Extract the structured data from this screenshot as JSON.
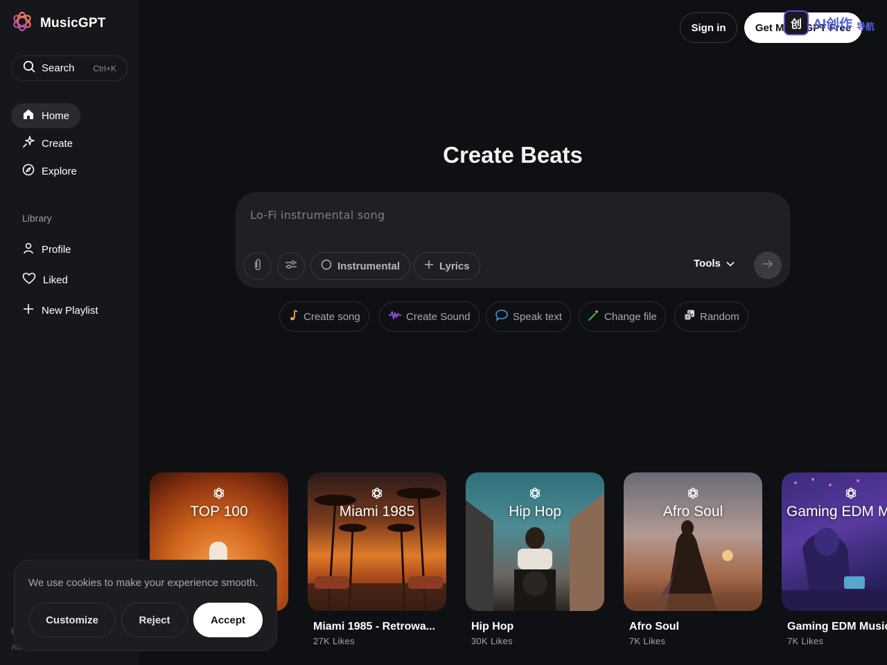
{
  "brand": {
    "name": "MusicGPT"
  },
  "sidebar": {
    "search": {
      "label": "Search",
      "shortcut": "Ctrl+K"
    },
    "nav": [
      {
        "label": "Home",
        "icon": "home-icon",
        "active": true
      },
      {
        "label": "Create",
        "icon": "sparkle-icon"
      },
      {
        "label": "Explore",
        "icon": "compass-icon"
      }
    ],
    "library_title": "Library",
    "library": [
      {
        "label": "Profile",
        "icon": "user-icon"
      },
      {
        "label": "Liked",
        "icon": "heart-icon"
      },
      {
        "label": "New Playlist",
        "icon": "plus-icon"
      }
    ],
    "footer_fragments": [
      "P",
      "Abo"
    ]
  },
  "header": {
    "signin_label": "Sign in",
    "cta_label": "Get MusicGPT Free",
    "overlay_badge": {
      "logo_char": "创",
      "text": "AI创作",
      "sub": "导航"
    }
  },
  "hero": {
    "title": "Create Beats",
    "prompt_placeholder": "Lo-Fi instrumental song",
    "instrumental_label": "Instrumental",
    "lyrics_label": "Lyrics",
    "tools_label": "Tools"
  },
  "quick_actions": [
    {
      "label": "Create song",
      "icon": "music-note-icon"
    },
    {
      "label": "Create Sound",
      "icon": "waveform-icon"
    },
    {
      "label": "Speak text",
      "icon": "speech-bubble-icon"
    },
    {
      "label": "Change file",
      "icon": "magic-wand-icon"
    },
    {
      "label": "Random",
      "icon": "dice-icon"
    }
  ],
  "cards": [
    {
      "art_label": "TOP 100",
      "title": "",
      "likes": ""
    },
    {
      "art_label": "Miami 1985",
      "title": "Miami 1985 - Retrowa...",
      "likes": "27K Likes"
    },
    {
      "art_label": "Hip Hop",
      "title": "Hip Hop",
      "likes": "30K Likes"
    },
    {
      "art_label": "Afro Soul",
      "title": "Afro Soul",
      "likes": "7K Likes"
    },
    {
      "art_label": "Gaming EDM M",
      "title": "Gaming EDM Music",
      "likes": "7K Likes"
    }
  ],
  "cookie": {
    "message": "We use cookies to make your experience smooth.",
    "customize_label": "Customize",
    "reject_label": "Reject",
    "accept_label": "Accept"
  },
  "colors": {
    "background": "#0f1014",
    "sidebar": "#16171b",
    "prompt_box": "#1f2024",
    "accent_orange": "#f08a3c",
    "accent_purple": "#a14de0"
  }
}
